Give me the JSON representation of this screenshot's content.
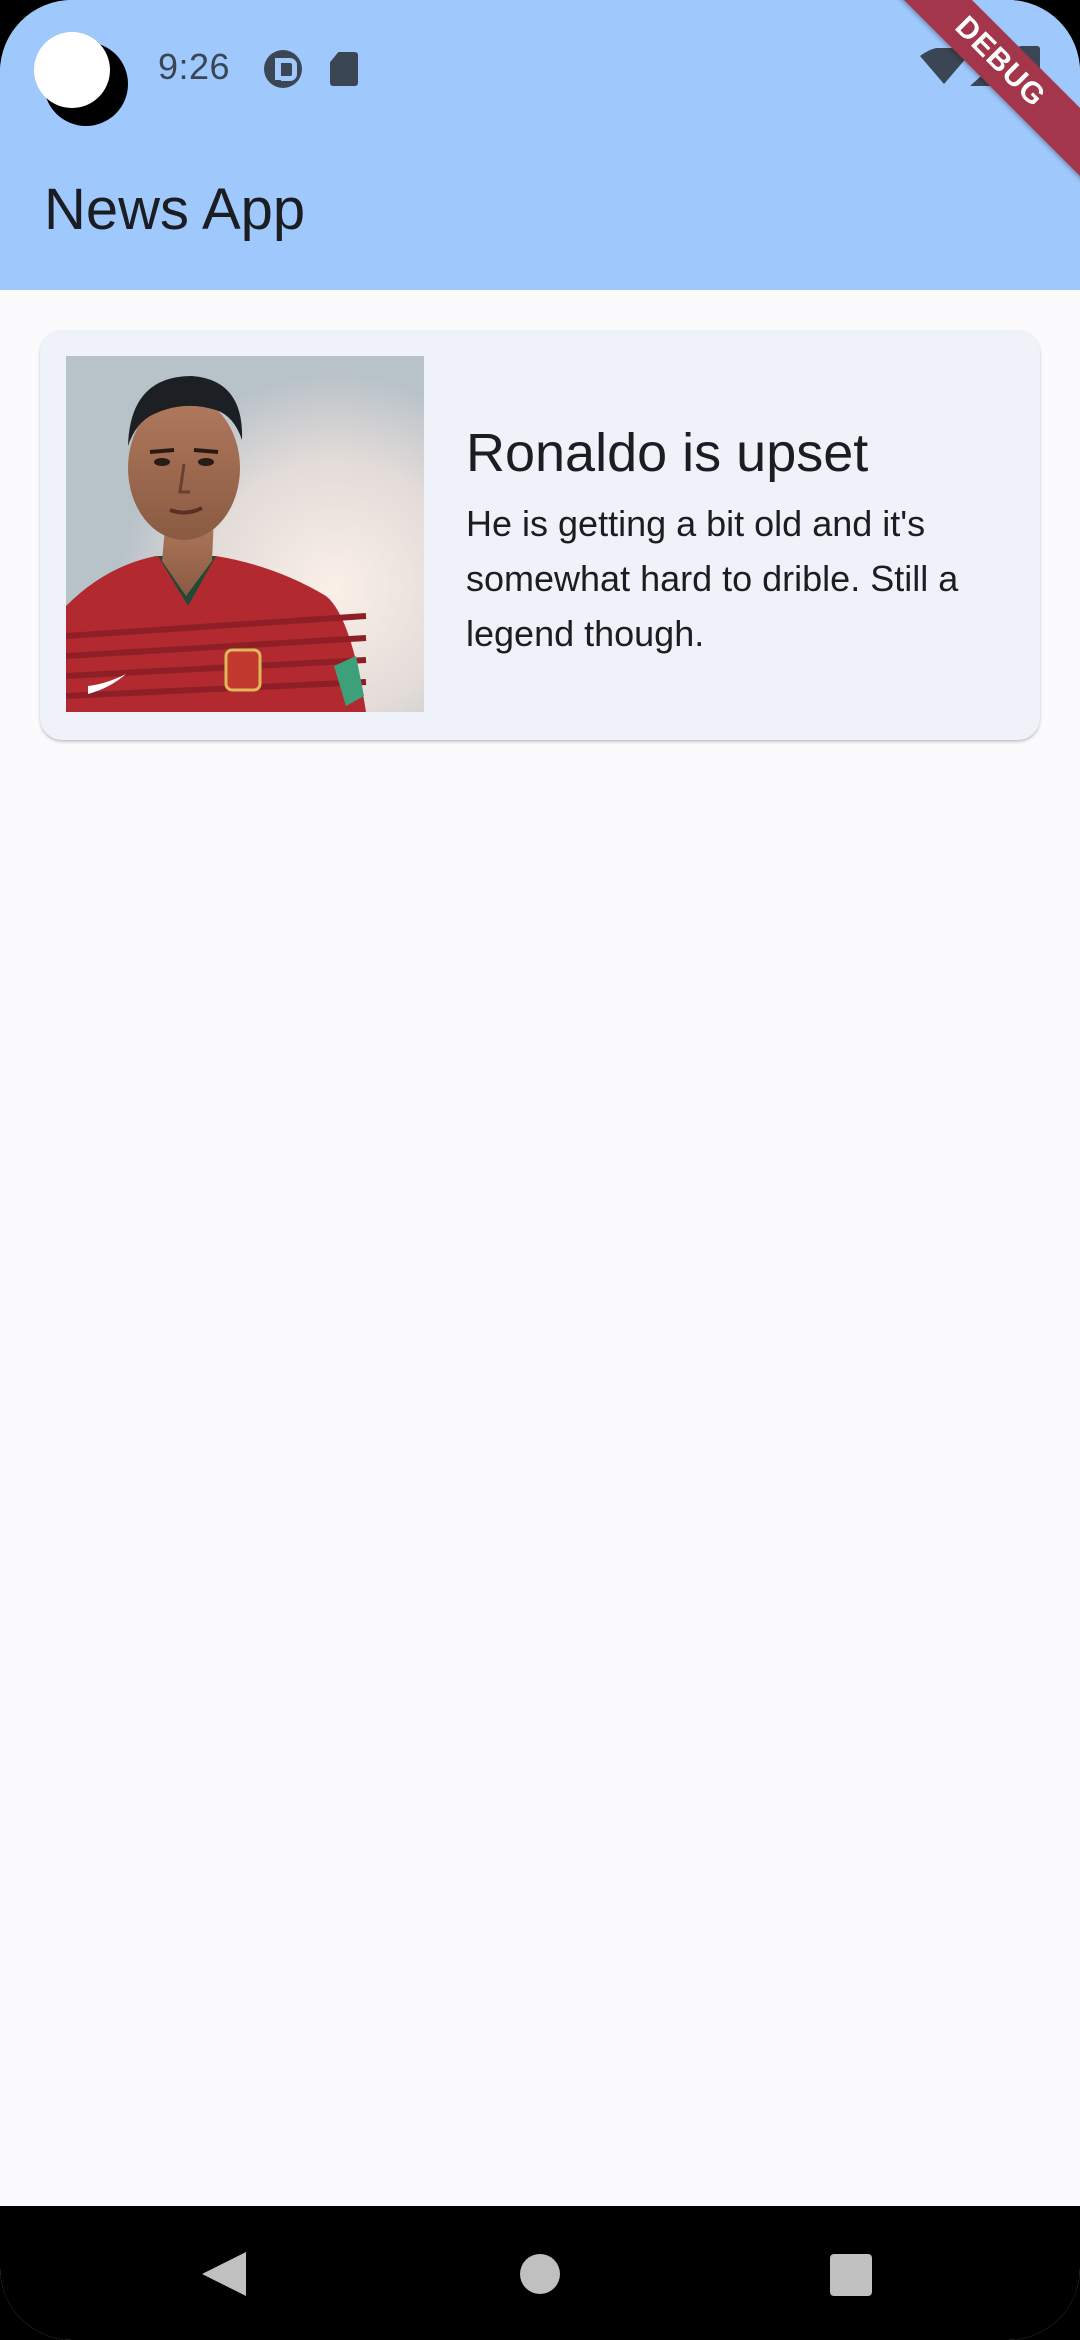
{
  "status_bar": {
    "time": "9:26"
  },
  "debug_banner": {
    "label": "DEBUG"
  },
  "app_bar": {
    "title": "News App"
  },
  "articles": [
    {
      "title": "Ronaldo is upset",
      "body": "He is getting a bit old and it's somewhat hard to drible. Still a legend though.",
      "image": "ronaldo-portrait"
    }
  ],
  "colors": {
    "header": "#9fc8fd",
    "background": "#fbfbfe",
    "card": "#eff2f9",
    "debug_banner": "#a3364a",
    "text": "#1c1d22"
  },
  "icons": {
    "status": [
      "camera-cutout",
      "status-p-icon",
      "sd-card-icon",
      "wifi-icon",
      "signal-icon",
      "battery-icon"
    ],
    "navigation": [
      "back-icon",
      "home-icon",
      "recents-icon"
    ]
  }
}
